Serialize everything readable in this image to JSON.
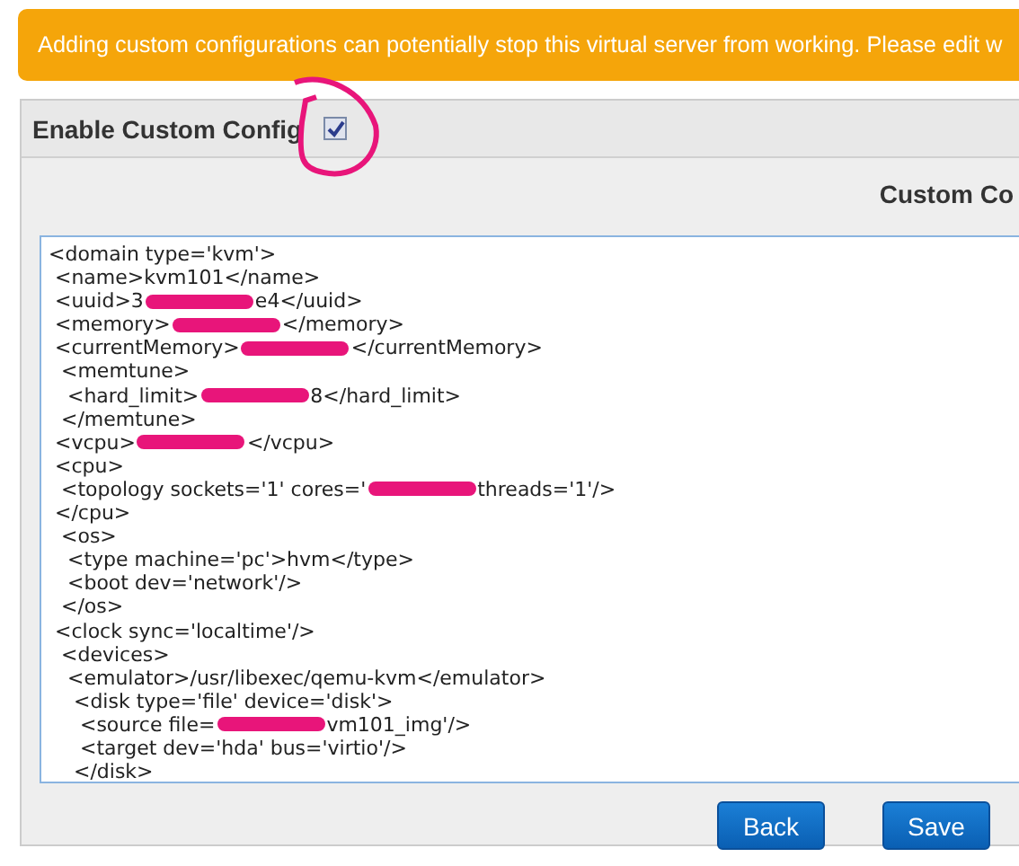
{
  "warning": "Adding custom configurations can potentially stop this virtual server from working. Please edit w",
  "custom_config": {
    "label": "Enable Custom Config",
    "checked": true
  },
  "editor": {
    "heading": "Custom Co",
    "lines": [
      {
        "segments": [
          "<domain type='kvm'>"
        ]
      },
      {
        "segments": [
          " <name>kvm101</name>"
        ]
      },
      {
        "segments": [
          " <uuid>3",
          "e4</uuid>"
        ]
      },
      {
        "segments": [
          " <memory>",
          "</memory>"
        ]
      },
      {
        "segments": [
          " <currentMemory>",
          "</currentMemory>"
        ]
      },
      {
        "segments": [
          "  <memtune>"
        ]
      },
      {
        "segments": [
          "   <hard_limit>",
          "8</hard_limit>"
        ]
      },
      {
        "segments": [
          "  </memtune>"
        ]
      },
      {
        "segments": [
          " <vcpu>",
          "</vcpu>"
        ]
      },
      {
        "segments": [
          " <cpu>"
        ]
      },
      {
        "segments": [
          "  <topology sockets='1' cores='",
          "threads='1'/>"
        ]
      },
      {
        "segments": [
          " </cpu>"
        ]
      },
      {
        "segments": [
          "  <os>"
        ]
      },
      {
        "segments": [
          "   <type machine='pc'>hvm</type>"
        ]
      },
      {
        "segments": [
          "   <boot dev='network'/>"
        ]
      },
      {
        "segments": [
          "  </os>"
        ]
      },
      {
        "segments": [
          " <clock sync='localtime'/>"
        ]
      },
      {
        "segments": [
          "  <devices>"
        ]
      },
      {
        "segments": [
          "   <emulator>/usr/libexec/qemu-kvm</emulator>"
        ]
      },
      {
        "segments": [
          "    <disk type='file' device='disk'>"
        ]
      },
      {
        "segments": [
          "     <source file=",
          "vm101_img'/>"
        ]
      },
      {
        "segments": [
          "     <target dev='hda' bus='virtio'/>"
        ]
      },
      {
        "segments": [
          "    </disk>"
        ]
      }
    ]
  },
  "buttons": [
    "Back",
    "Save"
  ]
}
